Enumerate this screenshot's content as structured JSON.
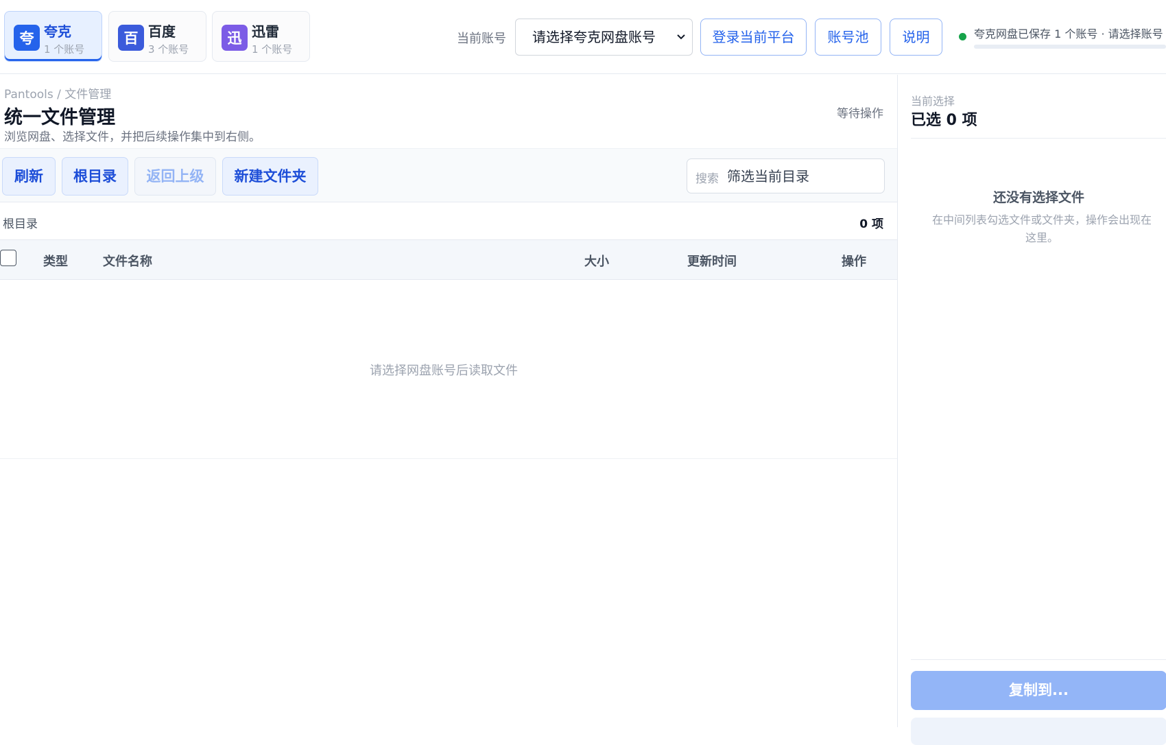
{
  "platforms": [
    {
      "badge": "夸",
      "name": "夸克",
      "count": "1 个账号",
      "color": "#2563eb",
      "active": true
    },
    {
      "badge": "百",
      "name": "百度",
      "count": "3 个账号",
      "color": "#3b5bdb",
      "active": false
    },
    {
      "badge": "迅",
      "name": "迅雷",
      "count": "1 个账号",
      "color": "#7c5ce6",
      "active": false
    }
  ],
  "account": {
    "label": "当前账号",
    "select_value": "请选择夸克网盘账号",
    "login_button": "登录当前平台",
    "pool_button": "账号池",
    "help_button": "说明"
  },
  "status": {
    "text": "夸克网盘已保存 1 个账号 · 请选择账号",
    "dot_color": "#16a34a"
  },
  "page": {
    "breadcrumb": "Pantools / 文件管理",
    "title": "统一文件管理",
    "subtitle": "浏览网盘、选择文件，并把后续操作集中到右侧。",
    "state": "等待操作"
  },
  "toolbar": {
    "refresh": "刷新",
    "root": "根目录",
    "up": "返回上级",
    "new_folder": "新建文件夹",
    "search_label": "搜索",
    "search_placeholder": "筛选当前目录"
  },
  "path": {
    "current": "根目录",
    "count": "0 项"
  },
  "table": {
    "columns": [
      "类型",
      "文件名称",
      "大小",
      "更新时间",
      "操作"
    ],
    "empty_text": "请选择网盘账号后读取文件"
  },
  "sidebar": {
    "label": "当前选择",
    "selected": "已选 0 项",
    "empty_title": "还没有选择文件",
    "empty_desc": "在中间列表勾选文件或文件夹，操作会出现在这里。",
    "copy_button": "复制到..."
  },
  "colors": {
    "accent": "#2563eb",
    "accent_light": "#eaf1fe",
    "disabled_button": "#93b5f7"
  }
}
